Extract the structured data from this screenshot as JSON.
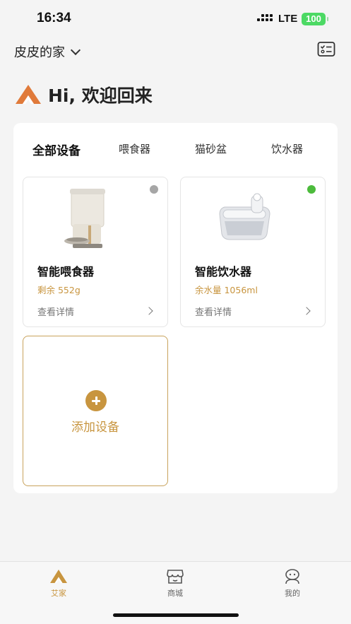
{
  "status_bar": {
    "time": "16:34",
    "network": "LTE",
    "battery": "100"
  },
  "header": {
    "home_name": "皮皮的家",
    "welcome": "Hi, 欢迎回来"
  },
  "tabs": [
    {
      "label": "全部设备",
      "active": true
    },
    {
      "label": "喂食器",
      "active": false
    },
    {
      "label": "猫砂盆",
      "active": false
    },
    {
      "label": "饮水器",
      "active": false
    }
  ],
  "devices": [
    {
      "name": "智能喂食器",
      "status": "剩余 552g",
      "detail_label": "查看详情",
      "online_color": "#a6a6a6",
      "icon": "feeder-icon"
    },
    {
      "name": "智能饮水器",
      "status": "余水量 1056ml",
      "detail_label": "查看详情",
      "online_color": "#4cbb3c",
      "icon": "water-fountain-icon"
    }
  ],
  "add_device": {
    "label": "添加设备"
  },
  "bottom_nav": [
    {
      "label": "艾家",
      "icon": "home-logo-icon",
      "active": true
    },
    {
      "label": "商城",
      "icon": "store-icon",
      "active": false
    },
    {
      "label": "我的",
      "icon": "profile-icon",
      "active": false
    }
  ],
  "colors": {
    "accent": "#c8953f",
    "brand_orange": "#e07a3a",
    "online": "#4cbb3c",
    "offline": "#a6a6a6"
  }
}
